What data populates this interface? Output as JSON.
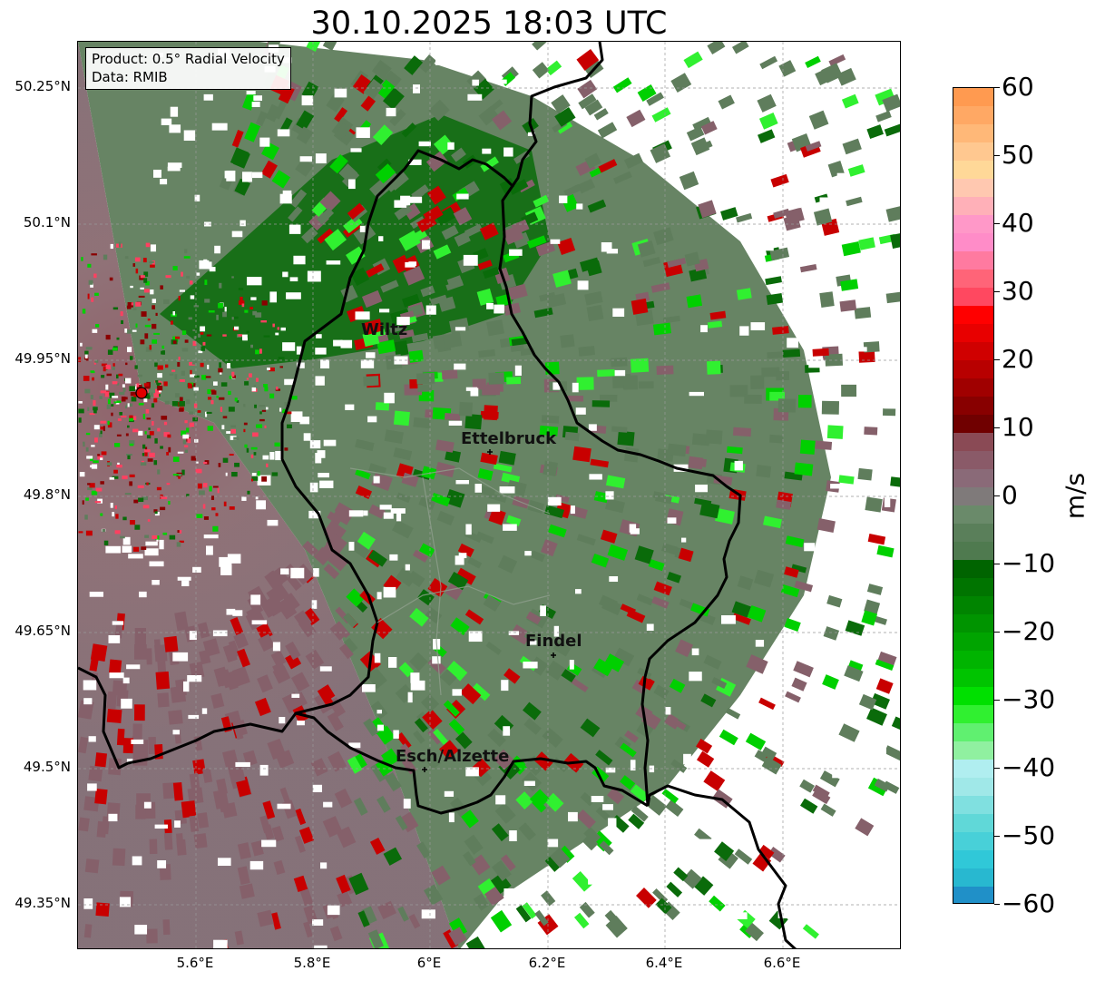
{
  "title": "30.10.2025 18:03 UTC",
  "info_box": {
    "product": "Product: 0.5° Radial Velocity",
    "source": "Data: RMIB"
  },
  "lat_labels": [
    "50.25°N",
    "50.1°N",
    "49.95°N",
    "49.8°N",
    "49.65°N",
    "49.5°N",
    "49.35°N"
  ],
  "lon_labels": [
    "5.6°E",
    "5.8°E",
    "6°E",
    "6.2°E",
    "6.4°E",
    "6.6°E"
  ],
  "cities": [
    "Wiltz",
    "Ettelbruck",
    "Findel",
    "Esch/Alzette"
  ],
  "colorbar": {
    "unit": "m/s",
    "ticks": [
      "60",
      "50",
      "40",
      "30",
      "20",
      "10",
      "0",
      "−10",
      "−20",
      "−30",
      "−40",
      "−50",
      "−60"
    ],
    "min": -60,
    "max": 60
  },
  "colors": {
    "approach_green": "#5f7f5c",
    "dark_green": "#006400",
    "bright_green": "#00d000",
    "recede_mauve": "#85606a",
    "red": "#c80000"
  }
}
